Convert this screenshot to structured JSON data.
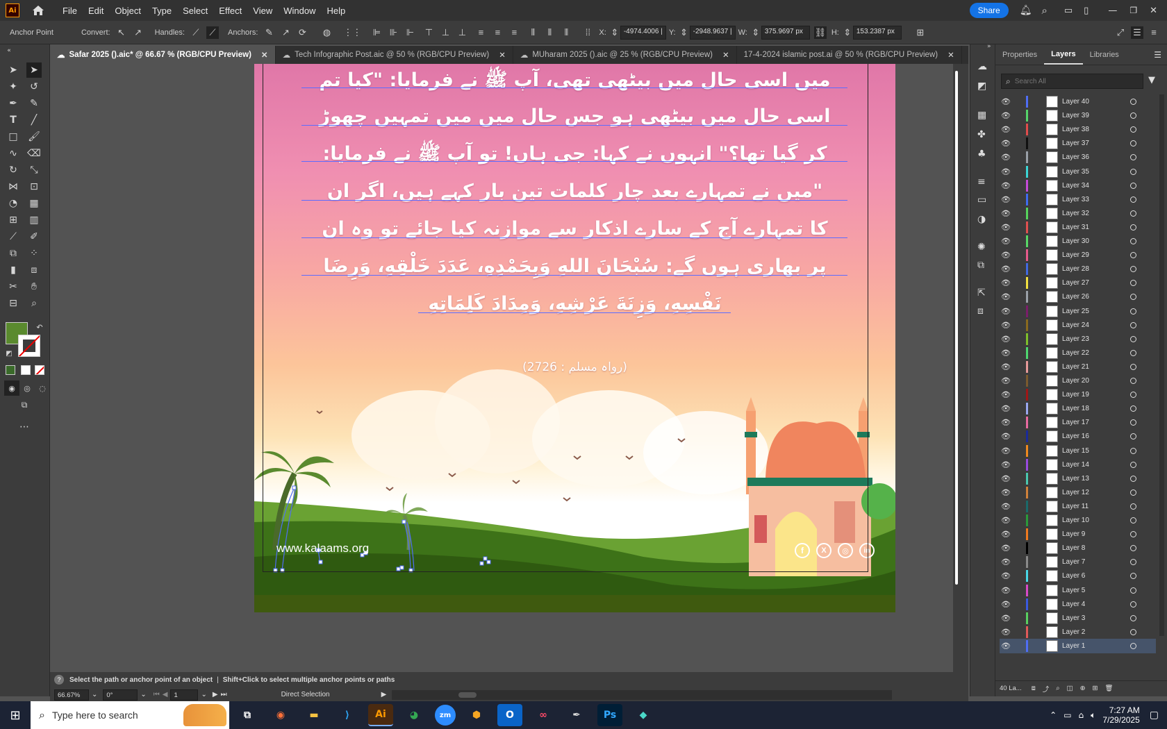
{
  "app": {
    "logo": "Ai",
    "home_icon": "home-icon"
  },
  "menu": [
    "File",
    "Edit",
    "Object",
    "Type",
    "Select",
    "Effect",
    "View",
    "Window",
    "Help"
  ],
  "top_right": {
    "share": "Share"
  },
  "control_bar": {
    "tool_label": "Anchor Point",
    "convert": "Convert:",
    "handles": "Handles:",
    "anchors": "Anchors:",
    "x_label": "X:",
    "x_value": "-4974.4006 |",
    "y_label": "Y:",
    "y_value": "-2948.9637 |",
    "w_label": "W:",
    "w_value": "375.9697 px",
    "h_label": "H:",
    "h_value": "153.2387 px"
  },
  "tabs": [
    {
      "label": "Safar 2025 ().aic* @ 66.67 % (RGB/CPU Preview)",
      "active": true
    },
    {
      "label": "Tech Infographic Post.aic @ 50 % (RGB/CPU Preview)",
      "active": false
    },
    {
      "label": "MUharam 2025 ().aic @ 25 % (RGB/CPU Preview)",
      "active": false
    },
    {
      "label": "17-4-2024 islamic post.ai @ 50 % (RGB/CPU Preview)",
      "active": false
    }
  ],
  "panel": {
    "tabs": [
      "Properties",
      "Layers",
      "Libraries"
    ],
    "active_tab": "Layers",
    "search_placeholder": "Search All",
    "layers": [
      {
        "name": "Layer 40",
        "color": "#4f6ef5"
      },
      {
        "name": "Layer 39",
        "color": "#55d46a"
      },
      {
        "name": "Layer 38",
        "color": "#e04c4c"
      },
      {
        "name": "Layer 37",
        "color": "#111111"
      },
      {
        "name": "Layer 36",
        "color": "#9aa0a8"
      },
      {
        "name": "Layer 35",
        "color": "#3bd6d6"
      },
      {
        "name": "Layer 34",
        "color": "#c54ad8"
      },
      {
        "name": "Layer 33",
        "color": "#3f6cf0"
      },
      {
        "name": "Layer 32",
        "color": "#56d45c"
      },
      {
        "name": "Layer 31",
        "color": "#e05050"
      },
      {
        "name": "Layer 30",
        "color": "#58d866"
      },
      {
        "name": "Layer 29",
        "color": "#e85a8c"
      },
      {
        "name": "Layer 28",
        "color": "#4169e1"
      },
      {
        "name": "Layer 27",
        "color": "#f2e040"
      },
      {
        "name": "Layer 26",
        "color": "#9aa0a8"
      },
      {
        "name": "Layer 25",
        "color": "#7a1e6a"
      },
      {
        "name": "Layer 24",
        "color": "#8a6a1e"
      },
      {
        "name": "Layer 23",
        "color": "#7fbf2a"
      },
      {
        "name": "Layer 22",
        "color": "#4fd870"
      },
      {
        "name": "Layer 21",
        "color": "#e79a9a"
      },
      {
        "name": "Layer 20",
        "color": "#7a5a2e"
      },
      {
        "name": "Layer 19",
        "color": "#a01616"
      },
      {
        "name": "Layer 18",
        "color": "#9aa8f0"
      },
      {
        "name": "Layer 17",
        "color": "#e86aa0"
      },
      {
        "name": "Layer 16",
        "color": "#1a2a9a"
      },
      {
        "name": "Layer 15",
        "color": "#f08a1e"
      },
      {
        "name": "Layer 14",
        "color": "#9a4ae0"
      },
      {
        "name": "Layer 13",
        "color": "#4ac8b0"
      },
      {
        "name": "Layer 12",
        "color": "#d0813a"
      },
      {
        "name": "Layer 11",
        "color": "#1a6a6a"
      },
      {
        "name": "Layer 10",
        "color": "#2a9a3a"
      },
      {
        "name": "Layer 9",
        "color": "#f07a1e"
      },
      {
        "name": "Layer 8",
        "color": "#000000"
      },
      {
        "name": "Layer 7",
        "color": "#8a8a8a"
      },
      {
        "name": "Layer 6",
        "color": "#48d8e8"
      },
      {
        "name": "Layer 5",
        "color": "#d84ac8"
      },
      {
        "name": "Layer 4",
        "color": "#3a5ae0"
      },
      {
        "name": "Layer 3",
        "color": "#58d060"
      },
      {
        "name": "Layer 2",
        "color": "#e05a5a"
      },
      {
        "name": "Layer 1",
        "color": "#4f6ef5"
      }
    ],
    "footer_count": "40 La..."
  },
  "artwork": {
    "urdu_lines": [
      "میں اسی حال میں بیٹھی تھی، آپ ﷺ نے فرمایا: \"کیا تم",
      "اسی حال میں بیٹھی ہو جس حال میں میں تمہیں چھوڑ",
      "کر گیا تھا؟\" انہوں نے کہا: جی ہاں! تو آپ ﷺ نے فرمایا:",
      "\"میں نے تمہارے بعد چار کلمات تین بار کہے ہیں، اگر ان",
      "کا تمہارے آج کے سارے اذکار سے موازنہ کیا جائے تو وہ ان",
      "پر بھاری ہوں گے: سُبْحَانَ اللهِ وَبِحَمْدِهِ، عَدَدَ خَلْقِهِ، وَرِضَا",
      "نَفْسِهِ، وَزِنَةَ عَرْشِهِ، وَمِدَادَ كَلِمَاتِهِ"
    ],
    "reference": "(رواہ مسلم : 2726)",
    "website": "www.kalaams.org",
    "social_icons": [
      "facebook-icon",
      "x-icon",
      "instagram-icon",
      "linkedin-icon"
    ]
  },
  "status": {
    "hint": "Select the path or anchor point of an object",
    "hint2": "Shift+Click to select multiple anchor points or paths",
    "zoom": "66.67%",
    "rotation": "0°",
    "artboard_num": "1",
    "tool": "Direct Selection"
  },
  "taskbar": {
    "search": "Type here to search",
    "time": "7:27 AM",
    "date": "7/29/2025"
  },
  "colors": {
    "accent": "#1473e6",
    "fill": "#5a8a2e",
    "ai_orange": "#ff9a00"
  }
}
